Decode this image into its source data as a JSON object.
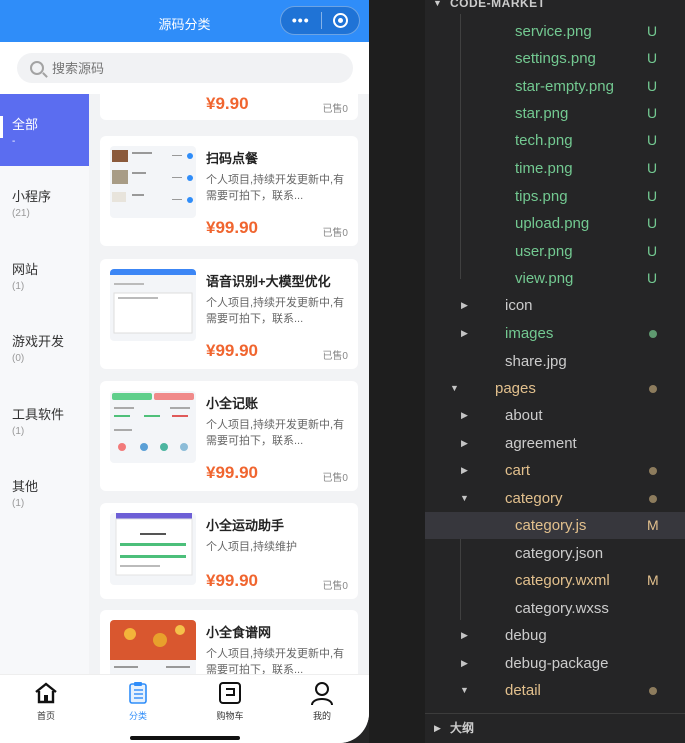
{
  "phone": {
    "title": "源码分类",
    "capsule_dots": "•••",
    "search_placeholder": "搜索源码",
    "categories": [
      {
        "name": "全部",
        "count": "-",
        "active": true
      },
      {
        "name": "小程序",
        "count": "(21)"
      },
      {
        "name": "网站",
        "count": "(1)"
      },
      {
        "name": "游戏开发",
        "count": "(0)"
      },
      {
        "name": "工具软件",
        "count": "(1)"
      },
      {
        "name": "其他",
        "count": "(1)"
      }
    ],
    "products": [
      {
        "title": "",
        "desc": "",
        "price": "¥9.90",
        "sold": "已售0"
      },
      {
        "title": "扫码点餐",
        "desc": "个人项目,持续开发更新中,有需要可拍下，联系...",
        "price": "¥99.90",
        "sold": "已售0"
      },
      {
        "title": "语音识别+大模型优化",
        "desc": "个人项目,持续开发更新中,有需要可拍下，联系...",
        "price": "¥99.90",
        "sold": "已售0"
      },
      {
        "title": "小全记账",
        "desc": "个人项目,持续开发更新中,有需要可拍下，联系...",
        "price": "¥99.90",
        "sold": "已售0"
      },
      {
        "title": "小全运动助手",
        "desc": "个人项目,持续维护",
        "price": "¥99.90",
        "sold": "已售0"
      },
      {
        "title": "小全食谱网",
        "desc": "个人项目,持续开发更新中,有需要可拍下，联系...",
        "price": "",
        "sold": ""
      }
    ],
    "tabs": [
      {
        "label": "首页",
        "icon": "home-icon"
      },
      {
        "label": "分类",
        "icon": "category-icon",
        "active": true
      },
      {
        "label": "购物车",
        "icon": "cart-icon"
      },
      {
        "label": "我的",
        "icon": "user-icon"
      }
    ],
    "colors": {
      "primary": "#2f8df9",
      "active_category": "#5b6df0",
      "price": "#f0652f"
    }
  },
  "explorer": {
    "root": "CODE-MARKET",
    "files": [
      {
        "label": "service.png",
        "badge": "U"
      },
      {
        "label": "settings.png",
        "badge": "U"
      },
      {
        "label": "star-empty.png",
        "badge": "U"
      },
      {
        "label": "star.png",
        "badge": "U"
      },
      {
        "label": "tech.png",
        "badge": "U"
      },
      {
        "label": "time.png",
        "badge": "U"
      },
      {
        "label": "tips.png",
        "badge": "U"
      },
      {
        "label": "upload.png",
        "badge": "U"
      },
      {
        "label": "user.png",
        "badge": "U"
      },
      {
        "label": "view.png",
        "badge": "U"
      }
    ],
    "folders": [
      {
        "label": "icon"
      },
      {
        "label": "images"
      },
      {
        "label": "share.jpg"
      },
      {
        "label": "pages"
      },
      {
        "label": "about"
      },
      {
        "label": "agreement"
      },
      {
        "label": "cart"
      },
      {
        "label": "category"
      },
      {
        "label": "category.js",
        "badge": "M"
      },
      {
        "label": "category.json"
      },
      {
        "label": "category.wxml",
        "badge": "M"
      },
      {
        "label": "category.wxss"
      },
      {
        "label": "debug"
      },
      {
        "label": "debug-package"
      },
      {
        "label": "detail"
      }
    ],
    "outline": "大纲",
    "colors": {
      "untracked": "#73c991",
      "modified": "#e2c08d",
      "text": "#cccccc"
    }
  }
}
